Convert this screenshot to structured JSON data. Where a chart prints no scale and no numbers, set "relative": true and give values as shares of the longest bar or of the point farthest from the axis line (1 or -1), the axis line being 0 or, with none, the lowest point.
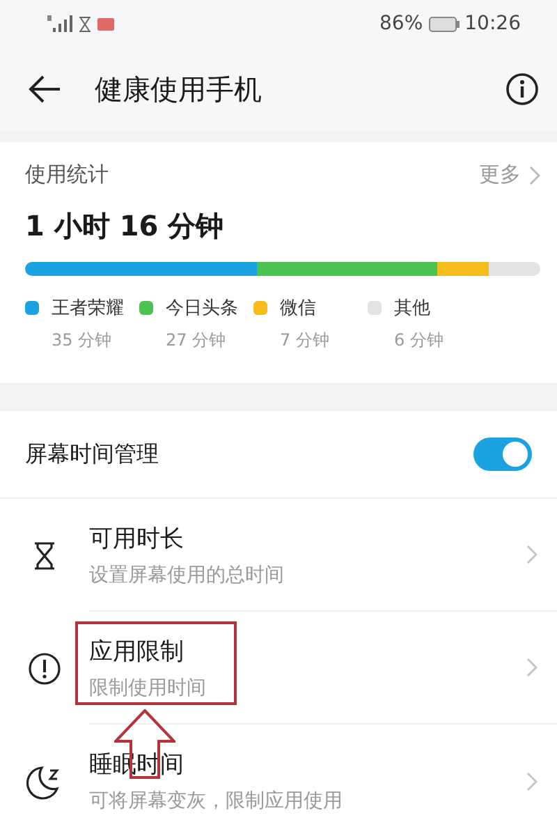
{
  "status_bar": {
    "battery": "86%",
    "time": "10:26"
  },
  "header": {
    "title": "健康使用手机"
  },
  "usage": {
    "title": "使用统计",
    "more": "更多",
    "total": "1 小时 16 分钟",
    "chart_data": {
      "type": "bar",
      "orientation": "horizontal",
      "stacked": true,
      "relative": true,
      "series": [
        {
          "name": "王者荣耀",
          "color": "#1aa3e0",
          "values": [
            0.45
          ]
        },
        {
          "name": "今日头条",
          "color": "#4cc250",
          "values": [
            0.35
          ]
        },
        {
          "name": "微信",
          "color": "#f5bd19",
          "values": [
            0.1
          ]
        },
        {
          "name": "其他",
          "color": "#e3e3e6",
          "values": [
            0.1
          ]
        }
      ]
    },
    "legend_times": [
      "35 分钟",
      "27 分钟",
      "7 分钟",
      "6 分钟"
    ]
  },
  "screen_time": {
    "label": "屏幕时间管理",
    "on": true,
    "items": [
      {
        "kind": "hourglass",
        "title": "可用时长",
        "subtitle": "设置屏幕使用的总时间",
        "annotated": false
      },
      {
        "kind": "alert",
        "title": "应用限制",
        "subtitle": "限制使用时间",
        "annotated": true
      },
      {
        "kind": "moon",
        "title": "睡眠时间",
        "subtitle": "可将屏幕变灰，限制应用使用",
        "annotated": false
      }
    ]
  }
}
